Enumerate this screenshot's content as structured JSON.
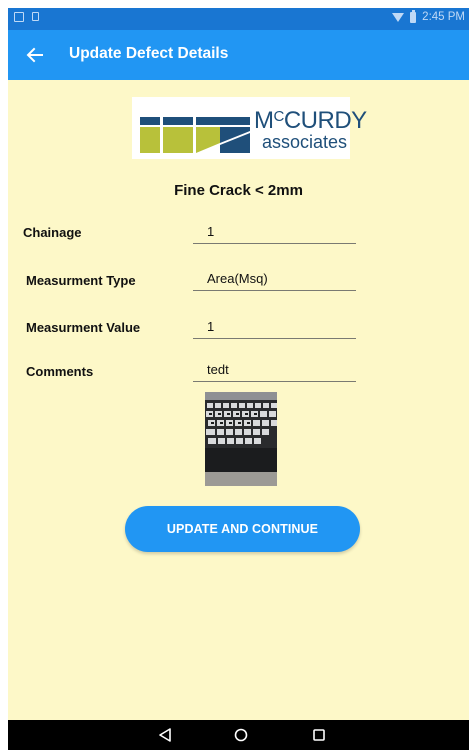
{
  "status_bar": {
    "time": "2:45 PM",
    "left_icons": [
      "image-icon",
      "sd-card-icon"
    ],
    "right_icons": [
      "wifi-icon",
      "battery-icon"
    ]
  },
  "app_bar": {
    "title": "Update Defect Details",
    "back_icon": "back-arrow-icon"
  },
  "logo": {
    "brand_prefix": "M",
    "brand_sup": "C",
    "brand_suffix": "CURDY",
    "subtitle": "associates",
    "colors": {
      "green": "#b8c13a",
      "navy": "#1f4f7a"
    }
  },
  "defect": {
    "title": "Fine Crack < 2mm"
  },
  "form": {
    "chainage": {
      "label": "Chainage",
      "value": "1"
    },
    "measurement_type": {
      "label": "Measurment Type",
      "value": "Area(Msq)"
    },
    "measurement_value": {
      "label": "Measurment Value",
      "value": "1"
    },
    "comments": {
      "label": "Comments",
      "value": "tedt"
    }
  },
  "photo": {
    "name": "keyboard-photo"
  },
  "actions": {
    "update_label": "UPDATE AND CONTINUE"
  },
  "nav_bar": {
    "icons": [
      "nav-back-icon",
      "nav-home-icon",
      "nav-recents-icon"
    ]
  },
  "colors": {
    "primary": "#2196f3",
    "primary_dark": "#1976d2",
    "background": "#fdf8c8"
  }
}
